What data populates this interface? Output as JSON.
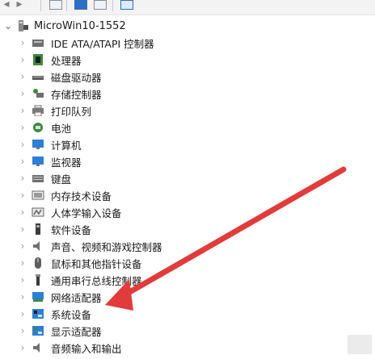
{
  "toolbar": {
    "back_glyph": "◂",
    "forward_glyph": "▸",
    "icons": [
      "properties-icon",
      "help-icon",
      "view-icon",
      "monitor-icon"
    ]
  },
  "tree": {
    "root": {
      "label": "MicroWin10-1552",
      "icon": "computer-icon",
      "expanded": true
    },
    "items": [
      {
        "label": "IDE ATA/ATAPI 控制器",
        "icon": "ide-controller-icon"
      },
      {
        "label": "处理器",
        "icon": "processor-icon"
      },
      {
        "label": "磁盘驱动器",
        "icon": "disk-drive-icon"
      },
      {
        "label": "存储控制器",
        "icon": "storage-controller-icon"
      },
      {
        "label": "打印队列",
        "icon": "print-queue-icon"
      },
      {
        "label": "电池",
        "icon": "battery-icon"
      },
      {
        "label": "计算机",
        "icon": "computer-monitor-icon"
      },
      {
        "label": "监视器",
        "icon": "monitor-icon"
      },
      {
        "label": "键盘",
        "icon": "keyboard-icon"
      },
      {
        "label": "内存技术设备",
        "icon": "memory-device-icon"
      },
      {
        "label": "人体学输入设备",
        "icon": "hid-icon"
      },
      {
        "label": "软件设备",
        "icon": "software-device-icon"
      },
      {
        "label": "声音、视频和游戏控制器",
        "icon": "sound-icon"
      },
      {
        "label": "鼠标和其他指针设备",
        "icon": "mouse-icon"
      },
      {
        "label": "通用串行总线控制器",
        "icon": "usb-icon"
      },
      {
        "label": "网络适配器",
        "icon": "network-adapter-icon"
      },
      {
        "label": "系统设备",
        "icon": "system-device-icon"
      },
      {
        "label": "显示适配器",
        "icon": "display-adapter-icon"
      },
      {
        "label": "音频输入和输出",
        "icon": "audio-io-icon"
      }
    ]
  },
  "colors": {
    "annotation_arrow": "#e03c3c",
    "icon_blue": "#2d7fd3",
    "icon_green": "#3d8a3d",
    "icon_gray": "#6f6f6f"
  }
}
